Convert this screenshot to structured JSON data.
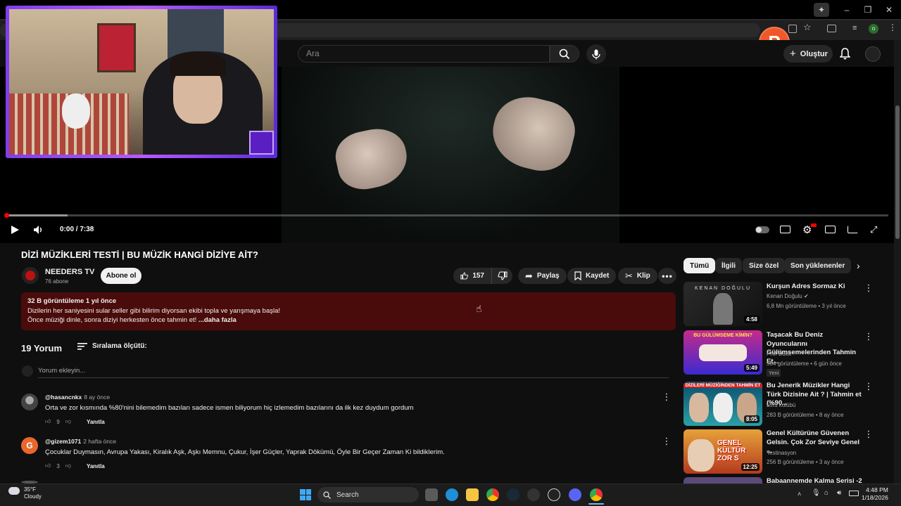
{
  "browser": {
    "extension_badge": "P"
  },
  "header": {
    "search_placeholder": "Ara",
    "create_label": "Oluştur"
  },
  "player": {
    "time": "0:00 / 7:38",
    "progress_fraction": 0.0
  },
  "video": {
    "title": "DİZİ MÜZİKLERİ TESTİ | BU MÜZİK HANGİ DİZİYE AİT?",
    "channel": "NEEDERS TV",
    "subscribers": "76 abone",
    "subscribe_label": "Abone ol",
    "likes": "157",
    "share_label": "Paylaş",
    "save_label": "Kaydet",
    "clip_label": "Klip"
  },
  "description": {
    "stats": "32 B görüntüleme  1 yıl önce",
    "line1": "Dizilerin her saniyesini sular seller gibi bilirim diyorsan ekibi topla ve yarışmaya başla!",
    "line2": "Önce müziği dinle, sonra diziyi herkesten önce tahmin et!",
    "more": "...daha fazla"
  },
  "comments": {
    "count_label": "19 Yorum",
    "sort_label": "Sıralama ölçütü:",
    "add_placeholder": "Yorum ekleyin...",
    "reply_label": "Yanıtla",
    "items": [
      {
        "author": "@hasancnkx",
        "time": "8 ay önce",
        "text": "Orta ve zor kısmında %80'nini bilemedim bazıları sadece ismen biliyorum hiç izlemedim bazılarını da ilk kez duydum gordum",
        "likes": "9"
      },
      {
        "author": "@gizem1071",
        "time": "2 hafta önce",
        "text": "Çocuklar Duymasın, Avrupa Yakası, Kiralık Aşk, Aşkı Memnu, Çukur, İşer Güçler, Yaprak Dökümü, Öyle Bir Geçer Zaman Ki bildiklerim.",
        "likes": "3",
        "avatar_letter": "G"
      }
    ]
  },
  "sidebar": {
    "chips": [
      "Tümü",
      "İlgili",
      "Size özel",
      "Son yüklenenler"
    ],
    "recommendations": [
      {
        "title": "Kurşun Adres Sormaz Ki",
        "channel": "Kenan Doğulu",
        "meta": "6,8 Mn görüntüleme • 3 yıl önce",
        "duration": "4:58",
        "thumb_text": "KENAN DOĞULU"
      },
      {
        "title": "Taşacak Bu Deniz Oyuncularını Gülümsemelerinden Tahmin Et...",
        "channel": "Prof Duck",
        "meta": "584 görüntüleme • 6 gün önce",
        "duration": "5:49",
        "badge": "Yeni",
        "thumb_text": "BU GÜLÜMSEME KİMİN?"
      },
      {
        "title": "Bu Jenerik Müzikler Hangi Türk Dizisine Ait ? | Tahmin et (%90...",
        "channel": "soru kulübü",
        "meta": "283 B görüntüleme • 8 ay önce",
        "duration": "8:05",
        "thumb_text": "DİZİLERİ MÜZİĞİNDEN TAHMİN ET"
      },
      {
        "title": "Genel Kültürüne Güvenen Gelsin. Çok Zor Seviye Genel ...",
        "channel": "Testinasyon",
        "meta": "256 B görüntüleme • 3 ay önce",
        "duration": "12:25",
        "thumb_text": "GENEL KÜLTÜR ZOR S"
      },
      {
        "title": "Babaannemde Kalma Serisi -2"
      }
    ]
  },
  "taskbar": {
    "temperature": "35°F",
    "condition": "Cloudy",
    "search_label": "Search",
    "time": "4:48 PM",
    "date": "1/18/2026"
  },
  "colors": {
    "accent_red": "#ff0000",
    "description_bg": "#4a0b0b",
    "webcam_border": "#9b4dff"
  }
}
